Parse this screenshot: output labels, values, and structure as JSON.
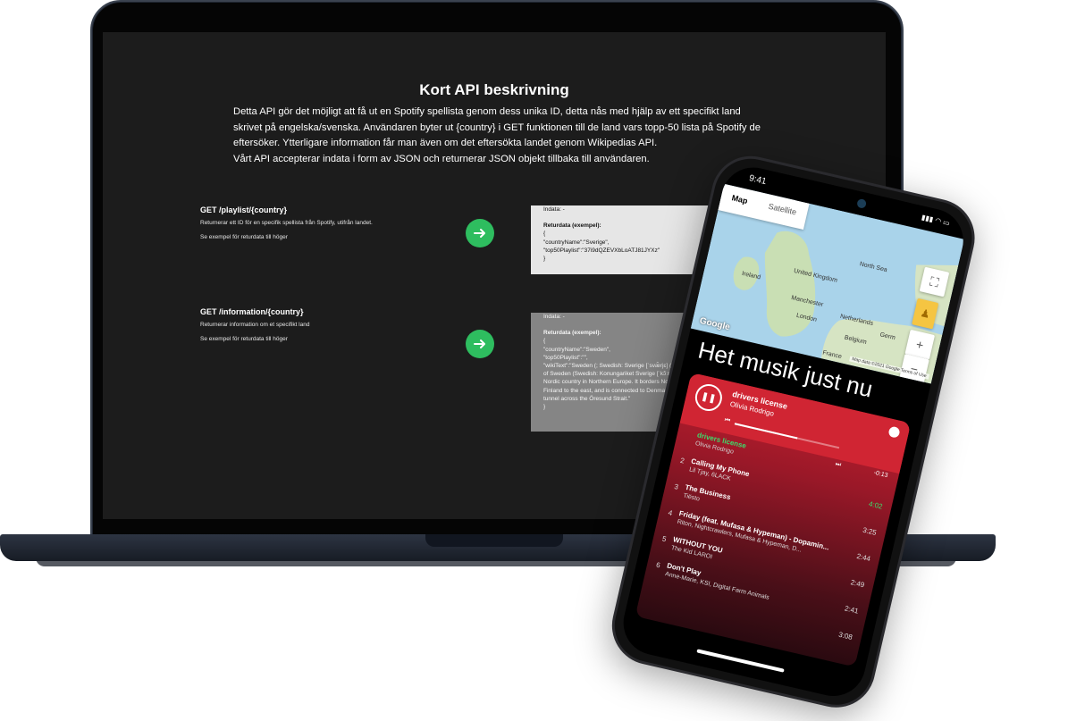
{
  "page": {
    "title": "Kort API beskrivning",
    "description": [
      "Detta API gör det möjligt att få ut en Spotify spellista genom dess unika ID, detta nås med hjälp av ett specifikt land skrivet på engelska/svenska. Användaren byter ut {country} i GET funktionen till de land vars topp-50 lista på Spotify de eftersöker. Ytterligare information får man även om det eftersökta landet genom Wikipedias API.",
      "Vårt API accepterar indata i form av JSON och returnerar JSON objekt tillbaka till användaren."
    ]
  },
  "endpoints": [
    {
      "title": "GET /playlist/{country}",
      "description": "Returnerar ett ID för en specifik spellista från Spotify, utifrån landet.",
      "note": "Se exempel för returdata till höger",
      "indata": "Indata: -",
      "returdata_label": "Returdata (exempel):",
      "returdata_lines": [
        "{",
        "\"countryName\":\"Sverige\",",
        "\"top50Playlist\":\"37i9dQZEVXbLoATJ81JYXz\"",
        "}"
      ]
    },
    {
      "title": "GET /information/{country}",
      "description": "Returnerar information om et specifikt land",
      "note": "Se exempel för returdata till höger",
      "indata": "Indata: -",
      "returdata_label": "Returdata (exempel):",
      "returdata_lines": [
        "{",
        "\"countryName\":\"Sweden\",",
        "\"top50Playlist\":\"\",",
        "\"wikiText\":\"Sweden (; Swedish: Sverige [ˈsvæ̌rjɛ] (listen)), officia",
        "of Sweden (Swedish: Konungariket Sverige [ˈkɔ̂ːnɵŋaˌriːkɛt ˈsvæ",
        "Nordic country in Northern Europe. It borders Norway to the w",
        "Finland to the east, and is connected to Denmark in the south",
        "tunnel across the Öresund Strait.\"",
        "}"
      ]
    }
  ],
  "phone": {
    "status_time": "9:41",
    "map": {
      "tabs": [
        "Map",
        "Satellite"
      ],
      "active_tab": "Map",
      "labels": [
        "United Kingdom",
        "Ireland",
        "North Sea",
        "London",
        "Netherlands",
        "Belgium",
        "Germ",
        "France",
        "Manchester"
      ],
      "google_logo": "Google",
      "attribution": "Map data ©2021 Google  Terms of Use",
      "zoom_in": "+",
      "zoom_out": "−"
    },
    "app_title": "Het musik just nu",
    "player": {
      "now_playing_title": "drivers license",
      "now_playing_artist": "Olivia Rodrigo",
      "remaining": "-0:13",
      "progress": 0.6,
      "tracks": [
        {
          "num": "",
          "title": "drivers license",
          "artist": "Olivia Rodrigo",
          "duration": "",
          "current": true
        },
        {
          "num": "2",
          "title": "Calling My Phone",
          "artist": "Lil Tjay, 6LACK",
          "duration": "4:02",
          "current": false
        },
        {
          "num": "3",
          "title": "The Business",
          "artist": "Tiësto",
          "duration": "3:25",
          "current": false
        },
        {
          "num": "4",
          "title": "Friday (feat. Mufasa & Hypeman) - Dopamin...",
          "artist": "Riton, Nightcrawlers, Mufasa & Hypeman, D...",
          "duration": "2:44",
          "current": false
        },
        {
          "num": "5",
          "title": "WITHOUT YOU",
          "artist": "The Kid LAROI",
          "duration": "2:49",
          "current": false
        },
        {
          "num": "6",
          "title": "Don't Play",
          "artist": "Anne-Marie, KSI, Digital Farm Animals",
          "duration": "2:41",
          "current": false
        },
        {
          "num": "",
          "title": "",
          "artist": "",
          "duration": "3:08",
          "current": false
        }
      ]
    }
  },
  "colors": {
    "screen_bg": "#1c1c1c",
    "arrow_green": "#2ebd5f",
    "player_red": "#c01f2e",
    "current_track_green": "#3ddc6b"
  }
}
